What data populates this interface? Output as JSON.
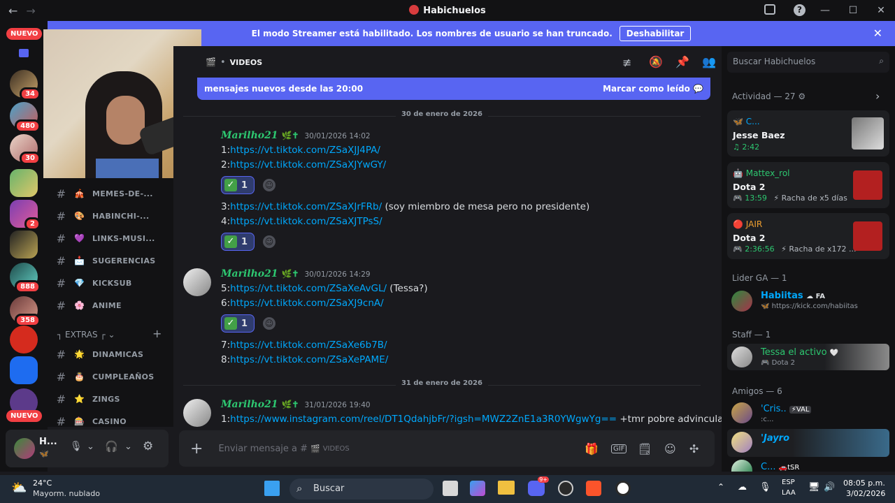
{
  "window": {
    "title": "Habichuelos"
  },
  "banner": {
    "text": "El modo Streamer está habilitado. Los nombres de usuario se han truncado.",
    "button": "Deshabilitar"
  },
  "servers": {
    "nuevo_top": "NUEVO",
    "nuevo_bottom": "NUEVO",
    "badges": [
      "34",
      "480",
      "30",
      "2",
      "888",
      "358"
    ]
  },
  "channels": {
    "items": [
      {
        "emoji": "🎪",
        "name": "MEMES-DE-..."
      },
      {
        "emoji": "🎨",
        "name": "HABINCHI-..."
      },
      {
        "emoji": "💜",
        "name": "LINKS-MUSI..."
      },
      {
        "emoji": "📩",
        "name": "SUGERENCIAS"
      },
      {
        "emoji": "💎",
        "name": "KICKSUB"
      },
      {
        "emoji": "🌸",
        "name": "ANIME"
      }
    ],
    "category": "EXTRAS",
    "items2": [
      {
        "emoji": "🌟",
        "name": "DINAMICAS"
      },
      {
        "emoji": "🎂",
        "name": "CUMPLEAÑOS"
      },
      {
        "emoji": "⭐",
        "name": "ZINGS"
      },
      {
        "emoji": "🎰",
        "name": "CASINO"
      }
    ]
  },
  "user": {
    "name": "H...",
    "status": "🦋"
  },
  "header": {
    "channel": "VIDEOS"
  },
  "unread": {
    "text": "mensajes nuevos desde las 20:00",
    "mark": "Marcar como leído"
  },
  "dates": [
    "30 de enero de 2026",
    "31 de enero de 2026"
  ],
  "messages": [
    {
      "author": "Marilho21",
      "ts": "30/01/2026 14:02",
      "l1p": "1:",
      "l1": "https://vt.tiktok.com/ZSaXJJ4PA/",
      "l2p": "2:",
      "l2": "https://vt.tiktok.com/ZSaXJYwGY/",
      "l3p": "3:",
      "l3": "https://vt.tiktok.com/ZSaXJrFRb/",
      "l3s": " (soy miembro de mesa pero no presidente)",
      "l4p": "4:",
      "l4": "https://vt.tiktok.com/ZSaXJTPsS/"
    },
    {
      "author": "Marilho21",
      "ts": "30/01/2026 14:29",
      "l1p": "5:",
      "l1": "https://vt.tiktok.com/ZSaXeAvGL/",
      "l1s": " (Tessa?)",
      "l2p": "6:",
      "l2": "https://vt.tiktok.com/ZSaXJ9cnA/",
      "l3p": "7:",
      "l3": "https://vt.tiktok.com/ZSaXe6b7B/",
      "l4p": "8:",
      "l4": "https://vt.tiktok.com/ZSaXePAME/"
    },
    {
      "author": "Marilho21",
      "ts": "31/01/2026 19:40",
      "l1p": "1:",
      "l1": "https://www.instagram.com/reel/DT1QdahjbFr/?igsh=MWZ2ZnE1a3R0YWgwYg==",
      "l1s": " +tmr pobre advincula"
    }
  ],
  "reaction": {
    "count": "1"
  },
  "composer": {
    "placeholder": "Enviar mensaje a #",
    "channel": "VIDEOS"
  },
  "search": {
    "placeholder": "Buscar Habichuelos"
  },
  "activity": {
    "header": "Actividad — 27",
    "cards": [
      {
        "user": "C...",
        "title": "Jesse Baez",
        "sub": "2:42",
        "streak": ""
      },
      {
        "user": "Mattex_rol",
        "title": "Dota 2",
        "sub": "13:59",
        "streak": "Racha de x5 días"
      },
      {
        "user": "JAIR",
        "title": "Dota 2",
        "sub": "2:36:56",
        "streak": "Racha de x172 ..."
      }
    ]
  },
  "members": {
    "lider_header": "Lider GA — 1",
    "lider": {
      "name": "Habiitas",
      "tag": "FA",
      "sub": "https://kick.com/habiitas"
    },
    "staff_header": "Staff — 1",
    "staff": {
      "name": "Tessa el activo",
      "sub": "Dota 2"
    },
    "amigos_header": "Amigos — 6",
    "amigos": [
      {
        "name": "'Cris..",
        "tag": "VAL",
        "sub": ":c..."
      },
      {
        "name": "'Jayro",
        "tag": "",
        "sub": ""
      },
      {
        "name": "C...",
        "tag": "tSR",
        "sub": ""
      }
    ]
  },
  "taskbar": {
    "temp": "24°C",
    "weather": "Mayorm. nublado",
    "search": "Buscar",
    "lang1": "ESP",
    "lang2": "LAA",
    "time": "08:05 p.m.",
    "date": "3/02/2026",
    "discord_badge": "9+"
  }
}
